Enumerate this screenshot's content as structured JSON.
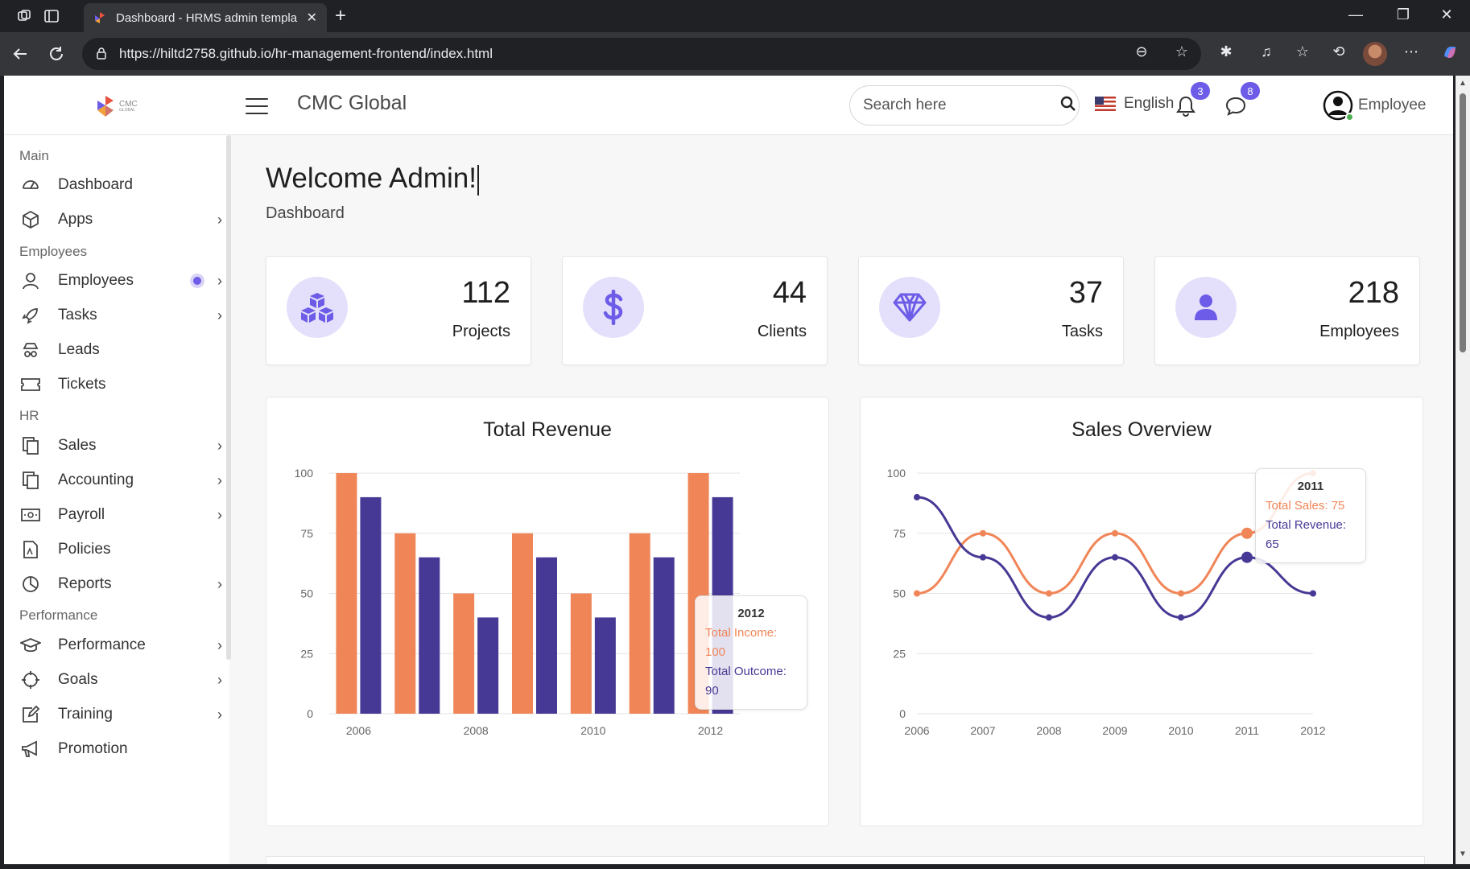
{
  "browser": {
    "tab_title": "Dashboard - HRMS admin templa",
    "url": "https://hiltd2758.github.io/hr-management-frontend/index.html"
  },
  "header": {
    "logo_text": "CMC",
    "logo_sub": "GLOBAL",
    "company": "CMC Global",
    "search_placeholder": "Search here",
    "language": "English",
    "notifications_count": "3",
    "messages_count": "8",
    "user_name": "Employee"
  },
  "sidebar": {
    "sections": [
      {
        "title": "Main"
      },
      {
        "title": "Employees"
      },
      {
        "title": "HR"
      },
      {
        "title": "Performance"
      }
    ],
    "items": [
      {
        "label": "Dashboard",
        "icon": "dashboard-icon"
      },
      {
        "label": "Apps",
        "icon": "cube-icon"
      },
      {
        "label": "Employees",
        "icon": "user-icon"
      },
      {
        "label": "Tasks",
        "icon": "rocket-icon"
      },
      {
        "label": "Leads",
        "icon": "spy-icon"
      },
      {
        "label": "Tickets",
        "icon": "ticket-icon"
      },
      {
        "label": "Sales",
        "icon": "files-icon"
      },
      {
        "label": "Accounting",
        "icon": "files-icon"
      },
      {
        "label": "Payroll",
        "icon": "money-icon"
      },
      {
        "label": "Policies",
        "icon": "document-icon"
      },
      {
        "label": "Reports",
        "icon": "pie-chart-icon"
      },
      {
        "label": "Performance",
        "icon": "graduation-cap-icon"
      },
      {
        "label": "Goals",
        "icon": "crosshair-icon"
      },
      {
        "label": "Training",
        "icon": "edit-icon"
      },
      {
        "label": "Promotion",
        "icon": "megaphone-icon"
      }
    ]
  },
  "main": {
    "welcome": "Welcome Admin!",
    "breadcrumb": "Dashboard",
    "stats": [
      {
        "value": "112",
        "label": "Projects",
        "icon": "cubes-icon"
      },
      {
        "value": "44",
        "label": "Clients",
        "icon": "dollar-icon"
      },
      {
        "value": "37",
        "label": "Tasks",
        "icon": "diamond-icon"
      },
      {
        "value": "218",
        "label": "Employees",
        "icon": "user-icon"
      }
    ]
  },
  "colors": {
    "accent": "#6c5ce7",
    "income": "#f08658",
    "outcome": "#463995"
  },
  "chart_data": [
    {
      "type": "bar",
      "title": "Total Revenue",
      "categories": [
        "2006",
        "2007",
        "2008",
        "2009",
        "2010",
        "2011",
        "2012"
      ],
      "x_tick_labels": [
        "2006",
        "2008",
        "2010",
        "2012"
      ],
      "series": [
        {
          "name": "Total Income",
          "values": [
            100,
            75,
            50,
            75,
            50,
            75,
            100
          ]
        },
        {
          "name": "Total Outcome",
          "values": [
            90,
            65,
            40,
            65,
            40,
            65,
            90
          ]
        }
      ],
      "ylim": [
        0,
        100
      ],
      "yticks": [
        0,
        25,
        50,
        75,
        100
      ],
      "grid": true,
      "tooltip": {
        "title": "2012",
        "lines": [
          "Total Income: 100",
          "Total Outcome: 90"
        ]
      }
    },
    {
      "type": "line",
      "title": "Sales Overview",
      "x": [
        "2006",
        "2007",
        "2008",
        "2009",
        "2010",
        "2011",
        "2012"
      ],
      "series": [
        {
          "name": "Total Sales",
          "values": [
            50,
            75,
            50,
            75,
            50,
            75,
            100
          ]
        },
        {
          "name": "Total Revenue",
          "values": [
            90,
            65,
            40,
            65,
            40,
            65,
            50
          ]
        }
      ],
      "ylim": [
        0,
        100
      ],
      "yticks": [
        0,
        25,
        50,
        75,
        100
      ],
      "grid": true,
      "tooltip": {
        "title": "2011",
        "lines": [
          "Total Sales: 75",
          "Total Revenue: 65"
        ]
      }
    }
  ]
}
